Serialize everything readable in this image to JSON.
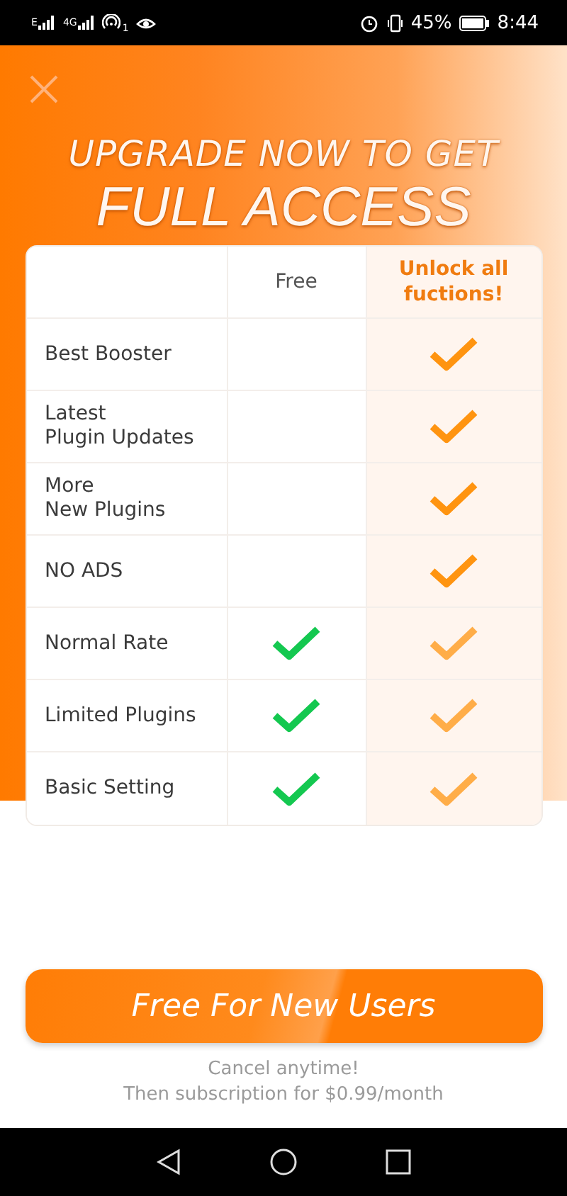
{
  "status_bar": {
    "network_labels": [
      "E",
      "4G"
    ],
    "hotspot_count": "1",
    "battery": "45%",
    "time": "8:44"
  },
  "headline": {
    "line_1": "UPGRADE NOW TO GET",
    "line_2": "FULL ACCESS"
  },
  "table": {
    "columns": [
      "Free",
      "Unlock all fuctions!"
    ],
    "rows": [
      {
        "label": "Best Booster",
        "free": false,
        "premium": true
      },
      {
        "label": "Latest\nPlugin Updates",
        "free": false,
        "premium": true
      },
      {
        "label": "More\nNew Plugins",
        "free": false,
        "premium": true
      },
      {
        "label": "NO ADS",
        "free": false,
        "premium": true
      },
      {
        "label": "Normal Rate",
        "free": true,
        "premium": true
      },
      {
        "label": "Limited Plugins",
        "free": true,
        "premium": true
      },
      {
        "label": "Basic Setting",
        "free": true,
        "premium": true
      }
    ]
  },
  "cta_button": "Free For New Users",
  "footnote": [
    "Cancel anytime!",
    "Then subscription for $0.99/month"
  ]
}
